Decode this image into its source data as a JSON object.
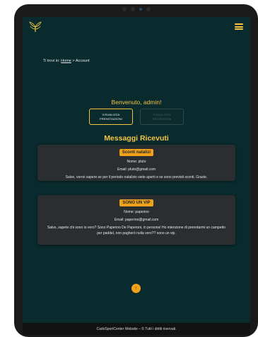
{
  "header": {
    "logo_icon": "laurel-logo-icon",
    "menu_icon": "hamburger-menu-icon",
    "accent": "#f4c542"
  },
  "breadcrumb": {
    "prefix": "Ti trovi in:",
    "home": "Home",
    "separator": ">",
    "current": "Account"
  },
  "welcome": "Benvenuto, admin!",
  "buttons": {
    "prenotazioni": "VISUALIZZA\nPRENOTAZIONI",
    "recensioni": "VISUALIZZA\nRECENSIONI"
  },
  "section_title": "Messaggi Ricevuti",
  "messages": [
    {
      "subject": "Sconti natalizi",
      "name": "Nome: pluto",
      "email": "Email: pluto@gmail.com",
      "text": "Salve, vorrei sapere se per il periodo natalizio siete aperti e se sono previsti sconti. Grazie."
    },
    {
      "subject": "SONO UN VIP",
      "name": "Nome: paperino",
      "email": "Email: paperino@gmail.com",
      "text": "Salve, sapete chi sono io vero? Sono Paperino De Paperoni, in persona! Ho intenzione di prenotarmi un campetto per paddel, non pagherò nulla vero?? sono un vip."
    }
  ],
  "scroll_top": {
    "icon": "arrow-up-icon",
    "glyph": "↑"
  },
  "footer": "CadoSportCenter Website – © Tutti i diritti riservati."
}
